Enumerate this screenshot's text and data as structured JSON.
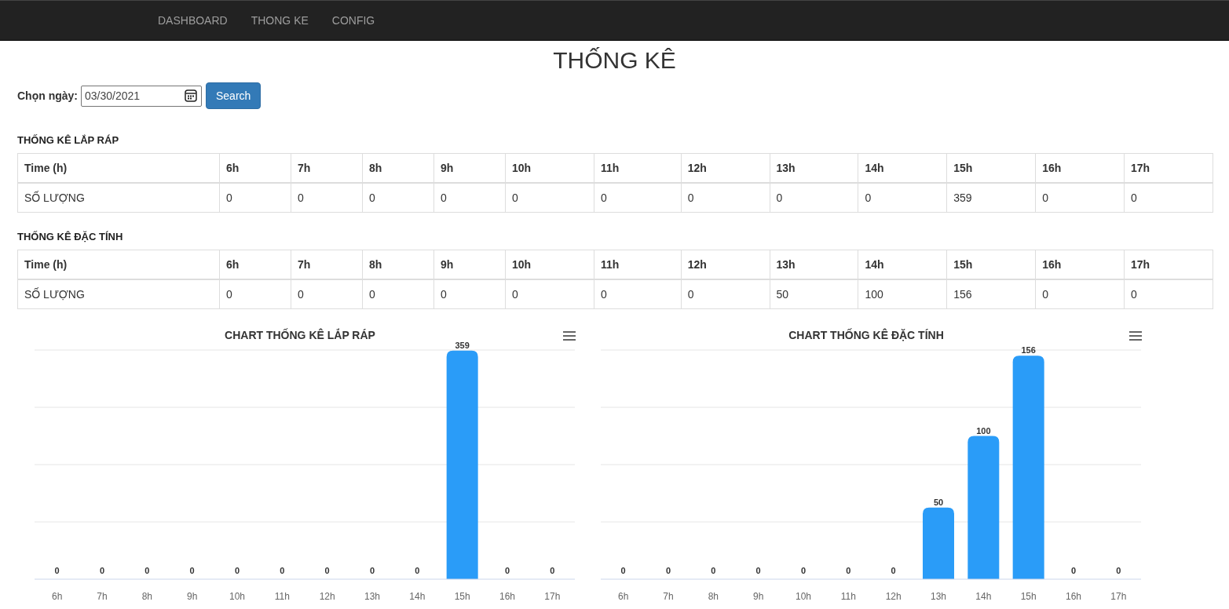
{
  "navbar": {
    "items": [
      {
        "label": "DASHBOARD"
      },
      {
        "label": "THONG KE"
      },
      {
        "label": "CONFIG"
      }
    ]
  },
  "page_title": "THỐNG KÊ",
  "date_filter": {
    "label": "Chọn ngày:",
    "value": "03/30/2021",
    "button": "Search"
  },
  "tables": [
    {
      "heading": "THỐNG KÊ LẮP RÁP",
      "columns": [
        "Time (h)",
        "6h",
        "7h",
        "8h",
        "9h",
        "10h",
        "11h",
        "12h",
        "13h",
        "14h",
        "15h",
        "16h",
        "17h"
      ],
      "rows": [
        [
          "SỐ LƯỢNG",
          "0",
          "0",
          "0",
          "0",
          "0",
          "0",
          "0",
          "0",
          "0",
          "359",
          "0",
          "0"
        ]
      ]
    },
    {
      "heading": "THỐNG KÊ ĐẶC TÍNH",
      "columns": [
        "Time (h)",
        "6h",
        "7h",
        "8h",
        "9h",
        "10h",
        "11h",
        "12h",
        "13h",
        "14h",
        "15h",
        "16h",
        "17h"
      ],
      "rows": [
        [
          "SỐ LƯỢNG",
          "0",
          "0",
          "0",
          "0",
          "0",
          "0",
          "0",
          "50",
          "100",
          "156",
          "0",
          "0"
        ]
      ]
    }
  ],
  "charts": [
    {
      "chart_data": {
        "type": "bar",
        "title": "CHART THỐNG KÊ LẮP RÁP",
        "categories": [
          "6h",
          "7h",
          "8h",
          "9h",
          "10h",
          "11h",
          "12h",
          "13h",
          "14h",
          "15h",
          "16h",
          "17h"
        ],
        "series": [
          {
            "color": "#2a9cf8",
            "values": [
              0,
              0,
              0,
              0,
              0,
              0,
              0,
              0,
              0,
              359,
              0,
              0
            ]
          }
        ],
        "ylim": [
          0,
          360
        ],
        "data_labels": true
      }
    },
    {
      "chart_data": {
        "type": "bar",
        "title": "CHART THỐNG KÊ ĐẶC TÍNH",
        "categories": [
          "6h",
          "7h",
          "8h",
          "9h",
          "10h",
          "11h",
          "12h",
          "13h",
          "14h",
          "15h",
          "16h",
          "17h"
        ],
        "series": [
          {
            "color": "#2a9cf8",
            "values": [
              0,
              0,
              0,
              0,
              0,
              0,
              0,
              50,
              100,
              156,
              0,
              0
            ]
          }
        ],
        "ylim": [
          0,
          160
        ],
        "data_labels": true
      }
    }
  ]
}
